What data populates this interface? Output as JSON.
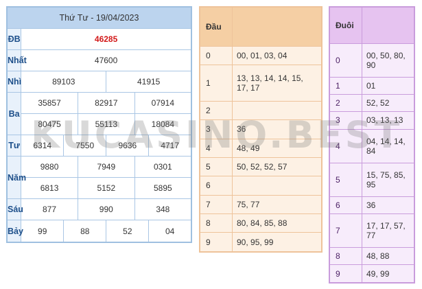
{
  "results": {
    "title": "Thứ Tư - 19/04/2023",
    "rows": {
      "db": {
        "label": "ĐB",
        "values": [
          "46285"
        ]
      },
      "nhat": {
        "label": "Nhất",
        "values": [
          "47600"
        ]
      },
      "nhi": {
        "label": "Nhì",
        "values": [
          "89103",
          "41915"
        ]
      },
      "ba": {
        "label": "Ba",
        "values": [
          "35857",
          "82917",
          "07914",
          "80475",
          "55113",
          "18084"
        ]
      },
      "tu": {
        "label": "Tư",
        "values": [
          "6314",
          "7550",
          "9636",
          "4717"
        ]
      },
      "nam": {
        "label": "Năm",
        "values": [
          "9880",
          "7949",
          "0301",
          "6813",
          "5152",
          "5895"
        ]
      },
      "sau": {
        "label": "Sáu",
        "values": [
          "877",
          "990",
          "348"
        ]
      },
      "bay": {
        "label": "Bảy",
        "values": [
          "99",
          "88",
          "52",
          "04"
        ]
      }
    }
  },
  "dau": {
    "header": "Đầu",
    "rows": [
      {
        "key": "0",
        "line1": "00, 01, 03, 04",
        "line2": ""
      },
      {
        "key": "1",
        "line1": "13, 13, 14, 14, 15,",
        "line2": "17, 17"
      },
      {
        "key": "2",
        "line1": "",
        "line2": ""
      },
      {
        "key": "3",
        "line1": "36",
        "line2": ""
      },
      {
        "key": "4",
        "line1": "48, 49",
        "line2": ""
      },
      {
        "key": "5",
        "line1": "50, 52, 52, 57",
        "line2": ""
      },
      {
        "key": "6",
        "line1": "",
        "line2": ""
      },
      {
        "key": "7",
        "line1": "75, 77",
        "line2": ""
      },
      {
        "key": "8",
        "line1": "80, 84, 85, 88",
        "line2": ""
      },
      {
        "key": "9",
        "line1": "90, 95, 99",
        "line2": ""
      }
    ]
  },
  "duoi": {
    "header": "Đuôi",
    "rows": [
      {
        "key": "0",
        "line1": "00, 50, 80,",
        "line2": "90"
      },
      {
        "key": "1",
        "line1": "01",
        "line2": ""
      },
      {
        "key": "2",
        "line1": "52, 52",
        "line2": ""
      },
      {
        "key": "3",
        "line1": "03, 13, 13",
        "line2": ""
      },
      {
        "key": "4",
        "line1": "04, 14, 14,",
        "line2": "84"
      },
      {
        "key": "5",
        "line1": "15, 75, 85,",
        "line2": "95"
      },
      {
        "key": "6",
        "line1": "36",
        "line2": ""
      },
      {
        "key": "7",
        "line1": "17, 17, 57,",
        "line2": "77"
      },
      {
        "key": "8",
        "line1": "48, 88",
        "line2": ""
      },
      {
        "key": "9",
        "line1": "49, 99",
        "line2": ""
      }
    ]
  },
  "watermark": "KUCASINO.BEST",
  "colors": {
    "results_header": "#bcd4ee",
    "results_label": "#1d4f8a",
    "special_prize": "#d21818",
    "dau_header": "#f5cfa4",
    "duoi_header": "#e6c3f0"
  }
}
